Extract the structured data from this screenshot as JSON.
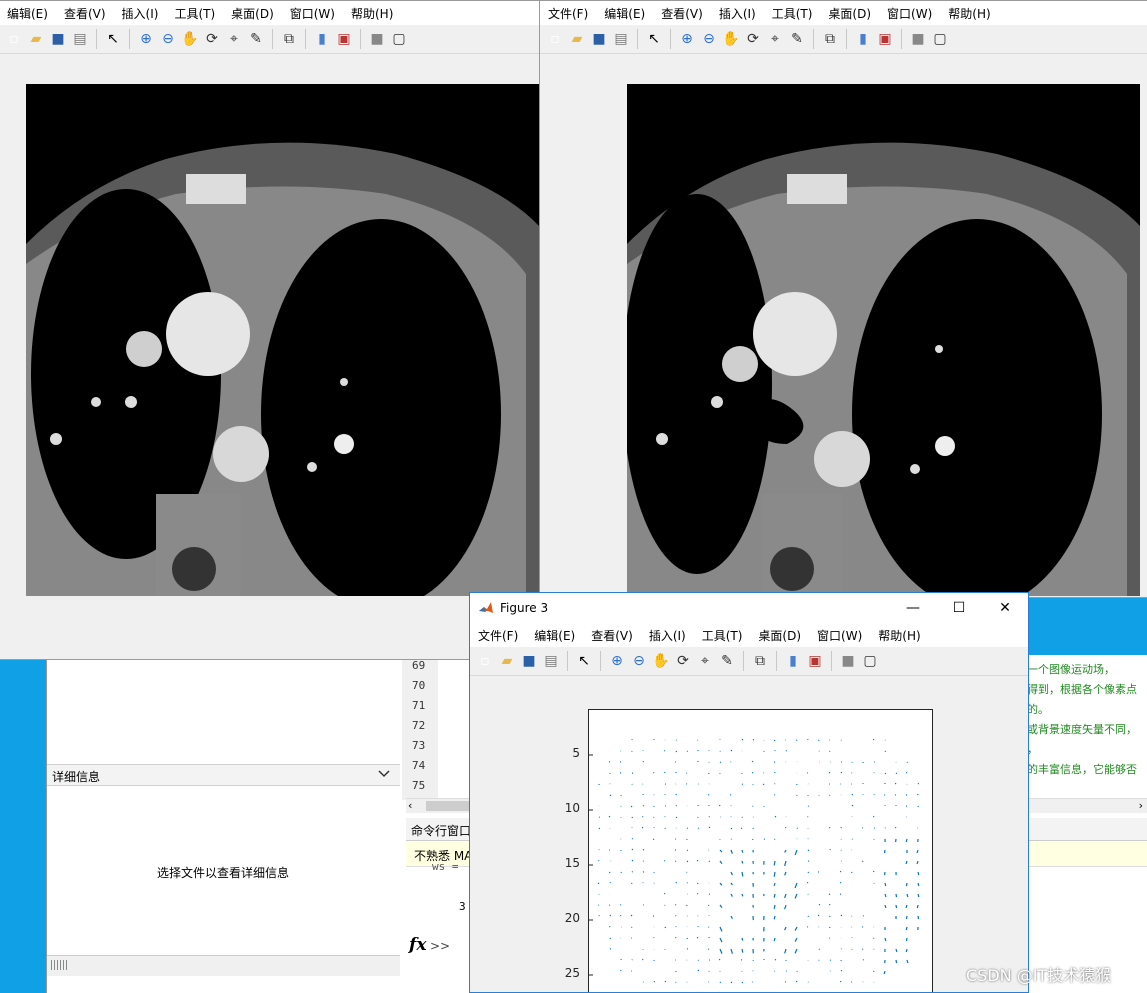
{
  "figure1": {
    "menu": [
      "编辑(E)",
      "查看(V)",
      "插入(I)",
      "工具(T)",
      "桌面(D)",
      "窗口(W)",
      "帮助(H)"
    ]
  },
  "figure2": {
    "menu": [
      "文件(F)",
      "编辑(E)",
      "查看(V)",
      "插入(I)",
      "工具(T)",
      "桌面(D)",
      "窗口(W)",
      "帮助(H)"
    ]
  },
  "matlab_bg": {
    "details_header": "详细信息",
    "details_placeholder": "选择文件以查看详细信息",
    "line_numbers": [
      "69",
      "70",
      "71",
      "72",
      "73",
      "74",
      "75"
    ],
    "command_window_label": "命令行窗口",
    "notice_text": "不熟悉 MA",
    "cmd_line1": "ws =",
    "cmd_line2": "3",
    "fx_symbol": "fx",
    "prompt": ">>",
    "comments": [
      "一个图像运动场，",
      "得到，根据各个像素点",
      "的。",
      "或背景速度矢量不同，",
      "，",
      "的丰富信息，它能够否"
    ]
  },
  "figure3": {
    "title": "Figure 3",
    "menu": [
      "文件(F)",
      "编辑(E)",
      "查看(V)",
      "插入(I)",
      "工具(T)",
      "桌面(D)",
      "窗口(W)",
      "帮助(H)"
    ],
    "yticks": [
      "5",
      "10",
      "15",
      "20",
      "25"
    ]
  },
  "watermark": "CSDN @IT技术猿猴",
  "colors": {
    "quiver": "#0072bd",
    "desktop": "#0fa0e6",
    "comment_green": "#228b22"
  }
}
